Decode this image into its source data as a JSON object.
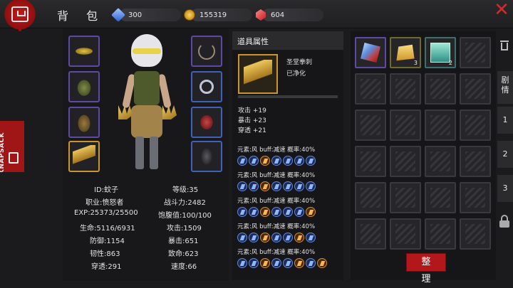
{
  "header": {
    "title": "背 包",
    "currencies": [
      {
        "icon": "blue-gem-icon",
        "value": "300"
      },
      {
        "icon": "gold-coin-icon",
        "value": "155319"
      },
      {
        "icon": "red-gem-icon",
        "value": "604"
      }
    ]
  },
  "side_tab_label": "KNAPSACK",
  "character": {
    "equipment_left": [
      {
        "icon": "goggles-icon"
      },
      {
        "icon": "vest-icon"
      },
      {
        "icon": "pants-icon"
      },
      {
        "icon": "claw-gauntlet-icon",
        "selected": true
      }
    ],
    "equipment_right": [
      {
        "icon": "necklace-icon"
      },
      {
        "icon": "ring-icon"
      },
      {
        "icon": "glove-icon"
      },
      {
        "icon": "boots-icon"
      }
    ],
    "stats": [
      [
        "ID:蚊子",
        "等级:35"
      ],
      [
        "职业:愤怒者",
        "战斗力:2482"
      ],
      [
        "EXP:25373/25500",
        "饱腹值:100/100"
      ],
      [
        "生命:5116/6931",
        "攻击:1509"
      ],
      [
        "防御:1154",
        "暴击:651"
      ],
      [
        "韧性:863",
        "致命:623"
      ],
      [
        "穿透:291",
        "速度:66"
      ]
    ]
  },
  "item_detail": {
    "header": "道具属性",
    "name": "圣堂拳刺",
    "state": "已净化",
    "base_stats": [
      "攻击 +19",
      "暴击 +23",
      "穿透 +21"
    ],
    "affixes": [
      {
        "text": "元素:风 buff:减速 概率:40%",
        "icons": [
          "b",
          "b",
          "o",
          "b",
          "b",
          "b",
          "b"
        ]
      },
      {
        "text": "元素:风 buff:减速 概率:40%",
        "icons": [
          "b",
          "b",
          "o",
          "b",
          "b",
          "b",
          "b"
        ]
      },
      {
        "text": "元素:风 buff:减速 概率:40%",
        "icons": [
          "b",
          "b",
          "o",
          "b",
          "b",
          "b",
          "o"
        ]
      },
      {
        "text": "元素:风 buff:减速 概率:40%",
        "icons": [
          "b",
          "b",
          "o",
          "b",
          "b",
          "o",
          "b"
        ]
      },
      {
        "text": "元素:风 buff:减速 概率:40%",
        "icons": [
          "b",
          "b",
          "o",
          "b",
          "b",
          "o",
          "b",
          "o"
        ]
      }
    ]
  },
  "inventory": {
    "items": [
      {
        "icon": "crystal-icon",
        "count": ""
      },
      {
        "icon": "gold-bar-icon",
        "count": "3"
      },
      {
        "icon": "card-icon",
        "count": "2"
      }
    ],
    "total_slots": 24,
    "sort_button": "整 理"
  },
  "right_tabs": [
    "剧情",
    "1",
    "2",
    "3"
  ]
}
